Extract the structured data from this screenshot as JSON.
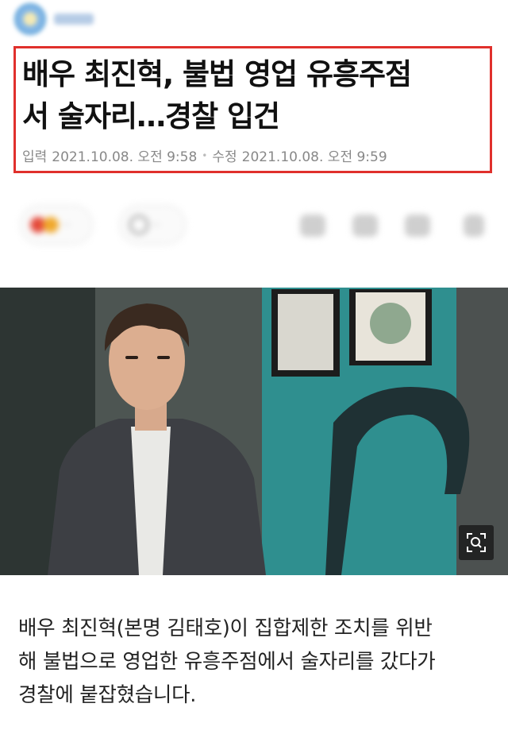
{
  "header": {
    "logo_icon": "site-logo-icon"
  },
  "article": {
    "title_line1": "배우 최진혁, 불법 영업 유흥주점",
    "title_line2": "서 술자리…경찰 입건",
    "input_label": "입력",
    "input_datetime": "2021.10.08. 오전 9:58",
    "edit_label": "수정",
    "edit_datetime": "2021.10.08. 오전 9:59",
    "body_line1": "배우 최진혁(본명 김태호)이 집합제한 조치를 위반",
    "body_line2": "해 불법으로 영업한 유흥주점에서 술자리를 갔다가",
    "body_line3": "경찰에 붙잡혔습니다."
  },
  "toolbar": {
    "reaction_icon": "reaction-icon",
    "comment_icon": "comment-icon",
    "tools": [
      "font-size-icon",
      "share-icon",
      "bookmark-icon",
      "more-icon"
    ]
  },
  "image": {
    "zoom_icon": "zoom-icon"
  },
  "colors": {
    "highlight_border": "#e0302c",
    "meta_text": "#888888",
    "photo_wall": "#2f8f8f"
  }
}
